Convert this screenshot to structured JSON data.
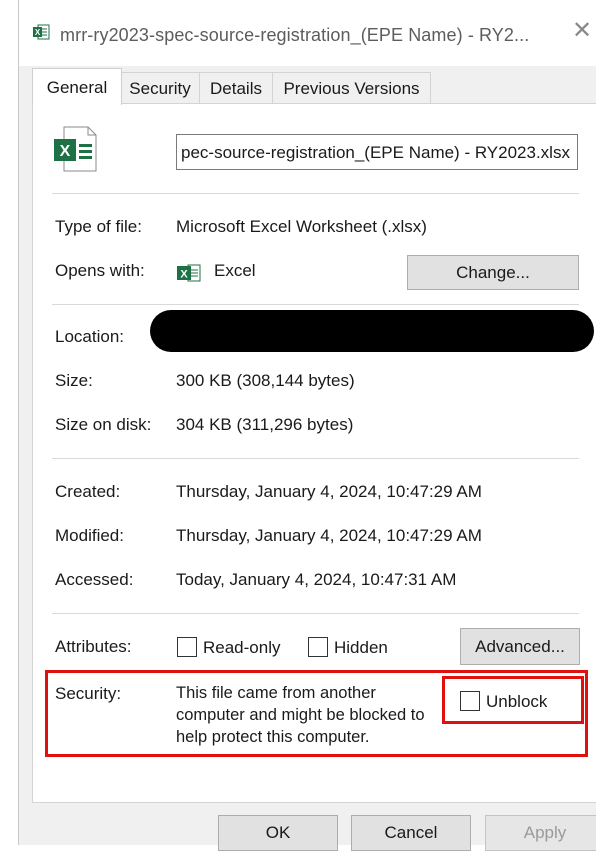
{
  "window": {
    "title": "mrr-ry2023-spec-source-registration_(EPE Name) - RY2...",
    "close_glyph": "✕"
  },
  "tabs": [
    {
      "label": "General",
      "active": true
    },
    {
      "label": "Security",
      "active": false
    },
    {
      "label": "Details",
      "active": false
    },
    {
      "label": "Previous Versions",
      "active": false
    }
  ],
  "file": {
    "name_field_value": "pec-source-registration_(EPE Name) - RY2023.xlsx",
    "icon": "excel-file-icon"
  },
  "properties": {
    "type_label": "Type of file:",
    "type_value": "Microsoft Excel Worksheet (.xlsx)",
    "opens_label": "Opens with:",
    "opens_value": "Excel",
    "opens_icon": "excel-app-icon",
    "change_button": "Change...",
    "location_label": "Location:",
    "size_label": "Size:",
    "size_value": "300 KB (308,144 bytes)",
    "size_disk_label": "Size on disk:",
    "size_disk_value": "304 KB (311,296 bytes)",
    "created_label": "Created:",
    "created_value": "Thursday, January 4, 2024, 10:47:29 AM",
    "modified_label": "Modified:",
    "modified_value": "Thursday, January 4, 2024, 10:47:29 AM",
    "accessed_label": "Accessed:",
    "accessed_value": "Today, January 4, 2024, 10:47:31 AM",
    "attributes_label": "Attributes:",
    "readonly_label": "Read-only",
    "hidden_label": "Hidden",
    "advanced_button": "Advanced...",
    "security_label": "Security:",
    "security_line1": "This file came from another",
    "security_line2": "computer and might be blocked to",
    "security_line3": "help protect this computer.",
    "unblock_label": "Unblock"
  },
  "footer": {
    "ok": "OK",
    "cancel": "Cancel",
    "apply": "Apply"
  },
  "colors": {
    "highlight": "#e01010",
    "excel_green": "#1e7145"
  }
}
